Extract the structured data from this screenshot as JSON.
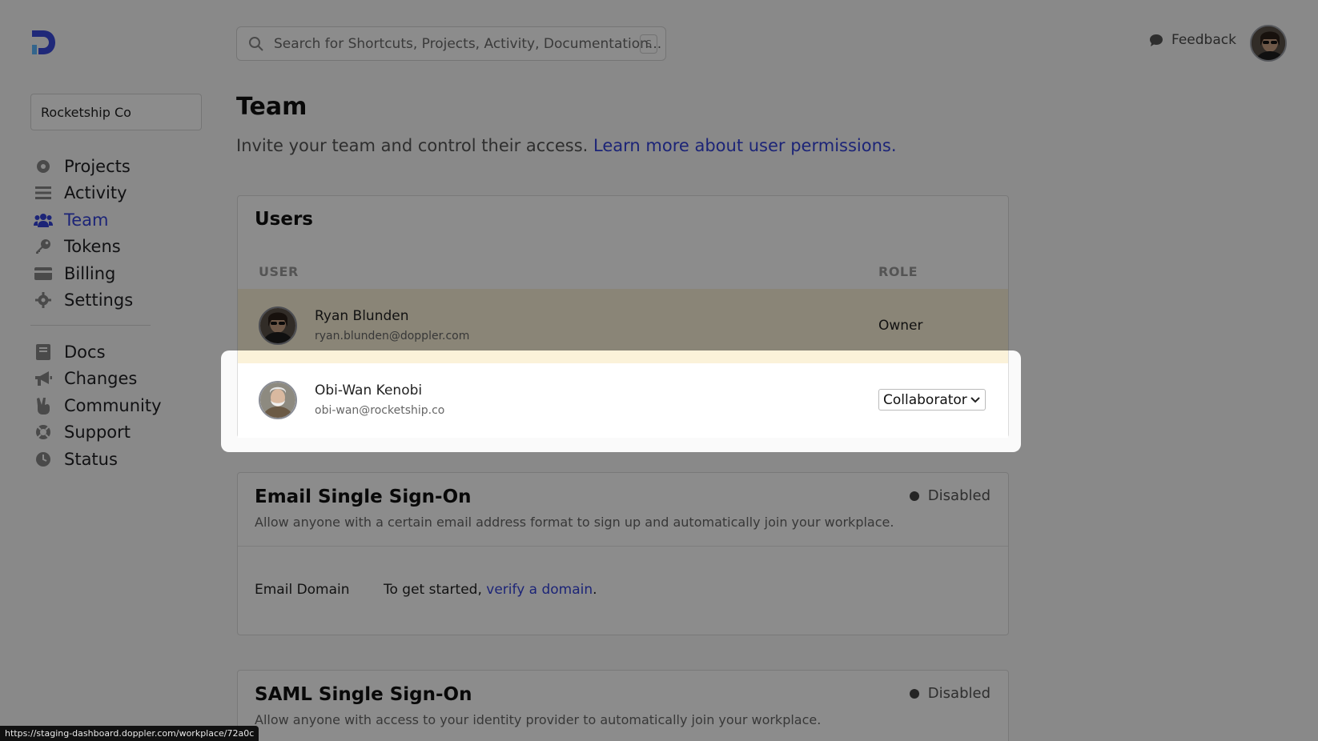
{
  "header": {
    "search_placeholder": "Search for Shortcuts, Projects, Activity, Documentation...",
    "search_shortcut": "S",
    "feedback_label": "Feedback"
  },
  "sidebar": {
    "workplace_name": "Rocketship Co",
    "primary": [
      {
        "label": "Projects",
        "icon": "projects-icon"
      },
      {
        "label": "Activity",
        "icon": "activity-icon"
      },
      {
        "label": "Team",
        "icon": "team-icon",
        "active": true
      },
      {
        "label": "Tokens",
        "icon": "key-icon"
      },
      {
        "label": "Billing",
        "icon": "credit-card-icon"
      },
      {
        "label": "Settings",
        "icon": "gear-icon"
      }
    ],
    "secondary": [
      {
        "label": "Docs",
        "icon": "book-icon"
      },
      {
        "label": "Changes",
        "icon": "megaphone-icon"
      },
      {
        "label": "Community",
        "icon": "peace-hand-icon"
      },
      {
        "label": "Support",
        "icon": "lifebuoy-icon"
      },
      {
        "label": "Status",
        "icon": "clock-icon"
      }
    ]
  },
  "main": {
    "title": "Team",
    "subtitle": "Invite your team and control their access.",
    "subtitle_link": "Learn more about user permissions.",
    "users": {
      "title": "Users",
      "col_user": "USER",
      "col_role": "ROLE",
      "rows": [
        {
          "name": "Ryan Blunden",
          "email": "ryan.blunden@doppler.com",
          "role": "Owner"
        },
        {
          "name": "Obi-Wan Kenobi",
          "email": "obi-wan@rocketship.co",
          "role": "Collaborator"
        }
      ]
    },
    "email_sso": {
      "title": "Email Single Sign-On",
      "status": "Disabled",
      "description": "Allow anyone with a certain email address format to sign up and automatically join your workplace.",
      "domain_label": "Email Domain",
      "domain_text": "To get started,",
      "domain_link": "verify a domain",
      "domain_end": "."
    },
    "saml_sso": {
      "title": "SAML Single Sign-On",
      "status": "Disabled",
      "description": "Allow anyone with access to your identity provider to automatically join your workplace."
    }
  },
  "status_bar_url": "https://staging-dashboard.doppler.com/workplace/72a0c",
  "colors": {
    "accent": "#3443d9",
    "owner_row": "#fbf2d9"
  }
}
